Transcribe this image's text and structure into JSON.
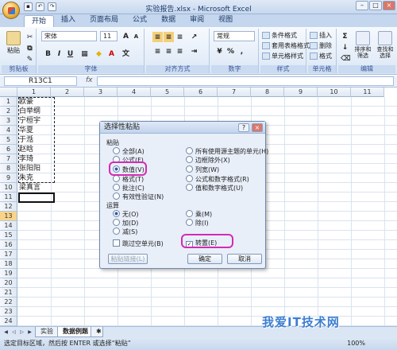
{
  "window": {
    "title": "实验报告.xlsx - Microsoft Excel"
  },
  "tabs": [
    "开始",
    "插入",
    "页面布局",
    "公式",
    "数据",
    "审阅",
    "视图"
  ],
  "ribbon": {
    "clipboard": {
      "paste": "粘贴",
      "label": "剪贴板"
    },
    "font": {
      "name": "宋体",
      "size": "11",
      "bold": "B",
      "italic": "I",
      "underline": "U",
      "grow": "A",
      "shrink": "A",
      "fontcolor": "A",
      "wen": "文",
      "label": "字体"
    },
    "align": {
      "label": "对齐方式"
    },
    "number": {
      "format": "常规",
      "percent": "%",
      "comma": ",",
      "label": "数字"
    },
    "styles": {
      "cond": "条件格式",
      "table": "套用表格格式",
      "cell": "单元格样式",
      "label": "样式"
    },
    "cells": {
      "insert": "插入",
      "delete": "删除",
      "format": "格式",
      "label": "单元格"
    },
    "edit": {
      "sum": "Σ",
      "sort": "排序和筛选",
      "find": "查找和选择",
      "label": "编辑"
    }
  },
  "formula_bar": {
    "namebox": "R13C1",
    "fx": "fx",
    "value": ""
  },
  "columns": [
    "1",
    "2",
    "3",
    "4",
    "5",
    "6",
    "7",
    "8",
    "9",
    "10",
    "11"
  ],
  "rows": [
    "1",
    "2",
    "3",
    "4",
    "5",
    "6",
    "7",
    "8",
    "9",
    "10",
    "11",
    "12",
    "13",
    "14",
    "15",
    "16",
    "17",
    "18",
    "19",
    "20",
    "21",
    "22",
    "23",
    "24"
  ],
  "cells": [
    "欧豪",
    "白举纲",
    "宁桓宇",
    "华夏",
    "于湉",
    "赵晗",
    "李琦",
    "张阳阳",
    "朱克",
    "梁真言"
  ],
  "dialog": {
    "title": "选择性粘贴",
    "help": "?",
    "close": "×",
    "paste_label": "粘贴",
    "paste_left": [
      "全部(A)",
      "公式(F)",
      "数值(V)",
      "格式(T)",
      "批注(C)",
      "有效性验证(N)"
    ],
    "paste_right": [
      "所有使用源主题的单元(H)",
      "边框除外(X)",
      "列宽(W)",
      "公式和数字格式(R)",
      "值和数字格式(U)"
    ],
    "op_label": "运算",
    "op_left": [
      "无(O)",
      "加(D)",
      "减(S)"
    ],
    "op_right": [
      "乘(M)",
      "除(I)"
    ],
    "skip_blanks": "跳过空单元(B)",
    "transpose": "转置(E)",
    "paste_link": "粘贴链接(L)",
    "ok": "确定",
    "cancel": "取消"
  },
  "sheets": [
    "实验",
    "数据例题"
  ],
  "status": "选定目标区域，然后按 ENTER 或选择“粘贴”",
  "zoom": "100%",
  "watermark": "我爱IT技术网",
  "colors": {
    "highlight": "#d42bb4",
    "ribbon": "#dbe7f6"
  }
}
